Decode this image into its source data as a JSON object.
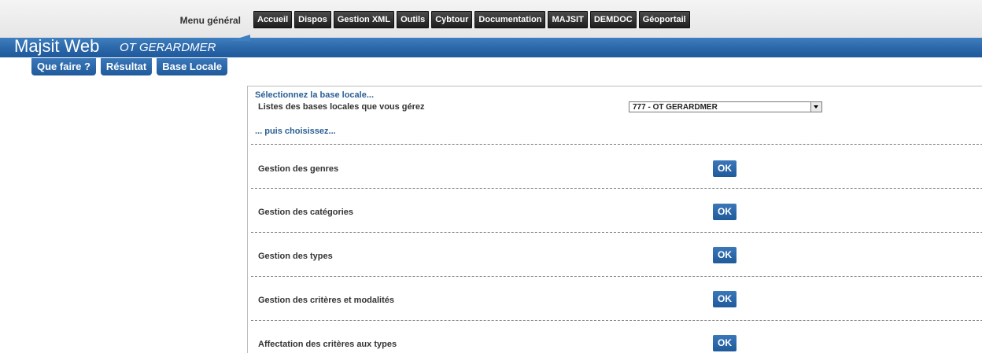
{
  "top_menu": {
    "label": "Menu général",
    "items": [
      "Accueil",
      "Dispos",
      "Gestion XML",
      "Outils",
      "Cybtour",
      "Documentation",
      "MAJSIT",
      "DEMDOC",
      "Géoportail"
    ]
  },
  "header": {
    "title": "Majsit Web",
    "subtitle": "OT GERARDMER"
  },
  "subtabs": [
    "Que faire ?",
    "Résultat",
    "Base Locale"
  ],
  "main": {
    "select_heading": "Sélectionnez la base locale...",
    "list_label": "Listes des bases locales que vous gérez",
    "selected_base": "777 - OT GERARDMER",
    "choose_heading": "... puis choisissez...",
    "rows": [
      {
        "label": "Gestion des genres",
        "button": "OK"
      },
      {
        "label": "Gestion des catégories",
        "button": "OK"
      },
      {
        "label": "Gestion des types",
        "button": "OK"
      },
      {
        "label": "Gestion des critères et modalités",
        "button": "OK"
      },
      {
        "label": "Affectation des critères aux types",
        "button": "OK"
      }
    ]
  },
  "colors": {
    "brand_blue": "#2a66a8",
    "heading_blue": "#2a5f96",
    "menu_dark": "#1e1e1e"
  }
}
